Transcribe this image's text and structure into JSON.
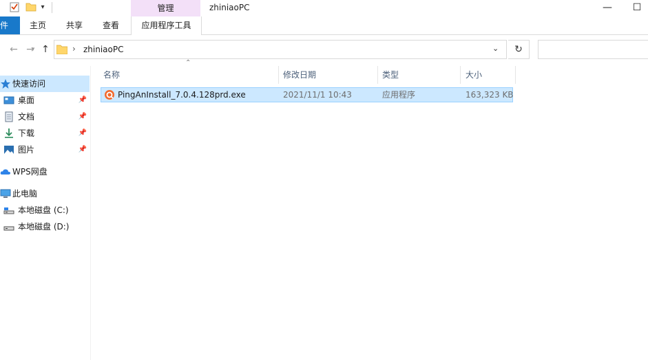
{
  "window": {
    "title": "zhiniaoPC",
    "context_tab": "管理",
    "minimize": "—",
    "maximize": "☐"
  },
  "ribbon": {
    "file_tab": "文件",
    "tabs": [
      "主页",
      "共享",
      "查看"
    ],
    "context_subtab": "应用程序工具"
  },
  "address": {
    "path_separator": "›",
    "current_folder": "zhiniaoPC"
  },
  "nav": {
    "items": [
      {
        "label": "快速访问",
        "icon": "star-icon",
        "pinned": false
      },
      {
        "label": "桌面",
        "icon": "desktop-icon",
        "pinned": true
      },
      {
        "label": "文档",
        "icon": "document-icon",
        "pinned": true
      },
      {
        "label": "下载",
        "icon": "download-icon",
        "pinned": true
      },
      {
        "label": "图片",
        "icon": "pictures-icon",
        "pinned": true
      },
      {
        "label": "WPS网盘",
        "icon": "cloud-icon",
        "pinned": false
      },
      {
        "label": "此电脑",
        "icon": "computer-icon",
        "pinned": false
      },
      {
        "label": "本地磁盘 (C:)",
        "icon": "drive-icon",
        "pinned": false
      },
      {
        "label": "本地磁盘 (D:)",
        "icon": "drive-icon",
        "pinned": false
      }
    ]
  },
  "columns": {
    "name": "名称",
    "modified": "修改日期",
    "type": "类型",
    "size": "大小"
  },
  "files": [
    {
      "name": "PingAnInstall_7.0.4.128prd.exe",
      "modified": "2021/11/1 10:43",
      "type": "应用程序",
      "size": "163,323 KB"
    }
  ],
  "colors": {
    "accent": "#1979ca",
    "selection": "#cce8ff",
    "context_tab": "#f3e0f8"
  }
}
